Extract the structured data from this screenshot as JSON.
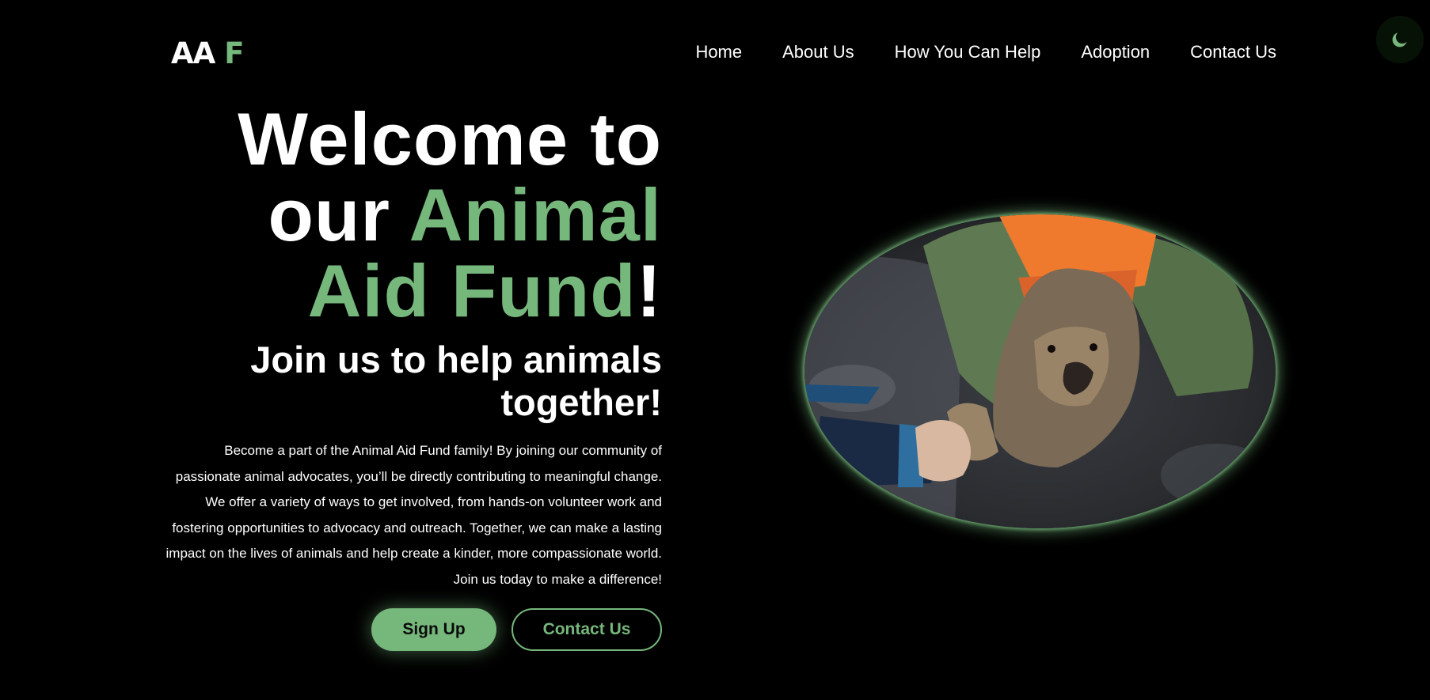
{
  "colors": {
    "accent": "#76b77c",
    "background": "#000000",
    "text": "#ffffff"
  },
  "logo": {
    "part1": "AA",
    "part2": "F"
  },
  "nav": {
    "items": [
      {
        "label": "Home"
      },
      {
        "label": "About Us"
      },
      {
        "label": "How You Can Help"
      },
      {
        "label": "Adoption"
      },
      {
        "label": "Contact Us"
      }
    ]
  },
  "theme_toggle": {
    "icon": "moon-icon"
  },
  "hero": {
    "headline_line1": "Welcome to",
    "headline_our": "our ",
    "headline_animal": "Animal",
    "headline_aid_fund": "Aid Fund",
    "headline_exclaim": "!",
    "subheadline": "Join us to help animals together!",
    "description": "Become a part of the Animal Aid Fund family! By joining our community of passionate animal advocates, you’ll be directly contributing to meaningful change. We offer a variety of ways to get involved, from hands-on volunteer work and fostering opportunities to advocacy and outreach. Together, we can make a lasting impact on the lives of animals and help create a kinder, more compassionate world. Join us today to make a difference!",
    "signup_label": "Sign Up",
    "contact_label": "Contact Us",
    "image_icon": "rescued-dog-photo"
  }
}
